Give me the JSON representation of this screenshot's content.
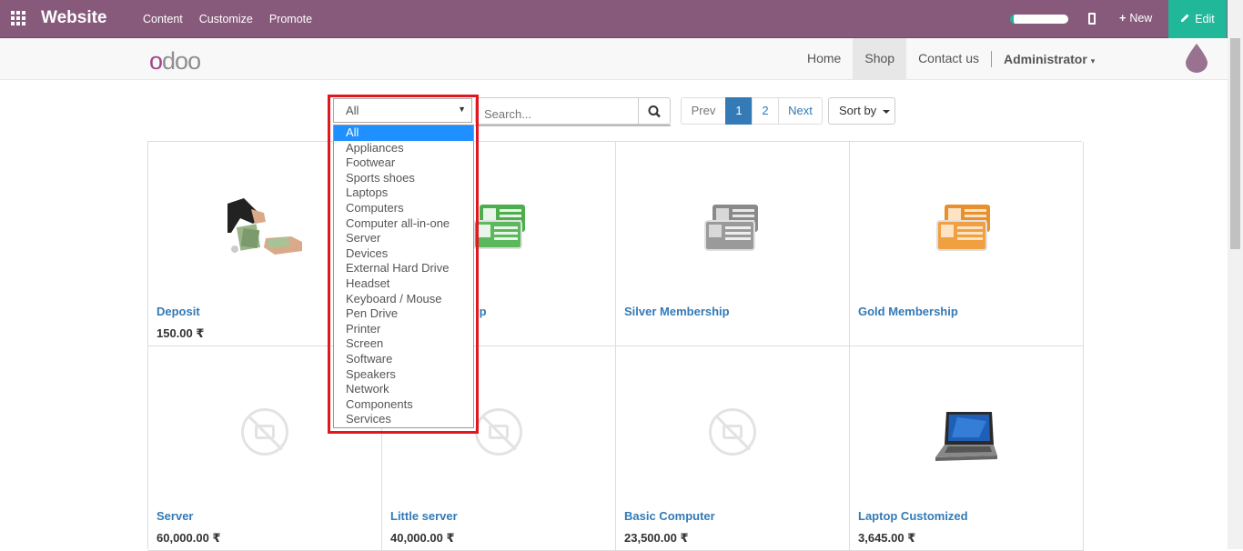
{
  "topbar": {
    "brand": "Website",
    "menu": [
      "Content",
      "Customize",
      "Promote"
    ],
    "new_label": "New",
    "edit_label": "Edit",
    "color": "#875a7b",
    "edit_color": "#21b799"
  },
  "nav": {
    "logo": {
      "o": "o",
      "rest": "doo"
    },
    "links": [
      "Home",
      "Shop",
      "Contact us"
    ],
    "active": "Shop",
    "user": "Administrator"
  },
  "toolbar": {
    "category_selected": "All",
    "search_placeholder": "Search...",
    "pager": {
      "prev": "Prev",
      "pages": [
        "1",
        "2"
      ],
      "current": "1",
      "next": "Next"
    },
    "sort_label": "Sort by"
  },
  "category_options": [
    "All",
    "Appliances",
    "Footwear",
    "Sports shoes",
    "Laptops",
    "Computers",
    "Computer all-in-one",
    "Server",
    "Devices",
    "External Hard Drive",
    "Headset",
    "Keyboard / Mouse",
    "Pen Drive",
    "Printer",
    "Screen",
    "Software",
    "Speakers",
    "Network",
    "Components",
    "Services"
  ],
  "products": [
    {
      "name": "Deposit",
      "price": "150.00 ₹",
      "image": "money-exchange"
    },
    {
      "name": "Membership",
      "price": "",
      "image": "green-membership-cards",
      "name_visible": "ip"
    },
    {
      "name": "Silver Membership",
      "price": "",
      "image": "silver-membership-cards"
    },
    {
      "name": "Gold Membership",
      "price": "",
      "image": "gold-membership-cards"
    },
    {
      "name": "Server",
      "price": "60,000.00 ₹",
      "image": "no-photo"
    },
    {
      "name": "Little server",
      "price": "40,000.00 ₹",
      "image": "no-photo"
    },
    {
      "name": "Basic Computer",
      "price": "23,500.00 ₹",
      "image": "no-photo"
    },
    {
      "name": "Laptop Customized",
      "price": "3,645.00 ₹",
      "image": "laptop"
    }
  ]
}
